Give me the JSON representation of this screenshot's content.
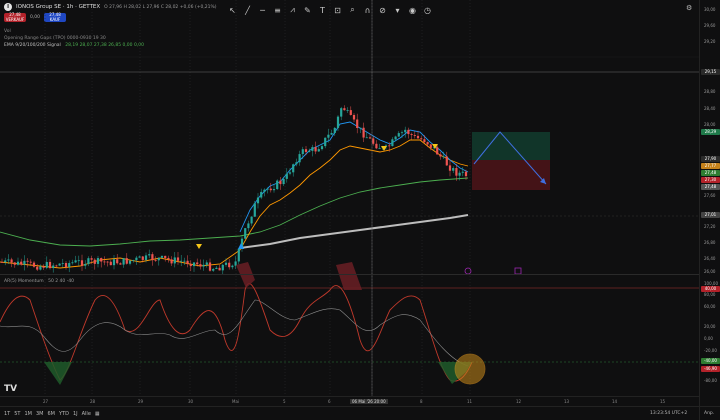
{
  "symbol": {
    "logo": "I",
    "title": "IONOS Group SE · 1h · GETTEX",
    "ohlc": "O 27,96  H 28,02  L 27,96  C 28,02  +0,06 (+0,21%)"
  },
  "trade": {
    "sell_price": "27,48",
    "sell_label": "VERKAUF",
    "spread": "0,00",
    "buy_price": "27,48",
    "buy_label": "KAUF"
  },
  "indicators": {
    "vol": "Vol",
    "vrp": "Opening Range Gaps (TPO) 0000-0930 19 30",
    "ema": "EMA 9/20/100/200 Signal",
    "ema_values": "28,19  28,07  27,38  26,85  0,00  0,00"
  },
  "toolbar_icons": [
    "cursor-icon",
    "line-icon",
    "hline-icon",
    "fib-icon",
    "pattern-icon",
    "brush-icon",
    "text-icon",
    "measure-icon",
    "zoom-icon",
    "magnet-icon",
    "lock-icon",
    "trash-icon",
    "eye-icon",
    "clock-icon"
  ],
  "price_axis": {
    "ticks": [
      "30,00",
      "29,60",
      "29,20",
      "28,80",
      "28,40",
      "28,00",
      "27,60",
      "27,20",
      "26,80",
      "26,40",
      "26,00"
    ],
    "crosshair_label": "29,15",
    "labels": [
      {
        "text": "28,29",
        "color": "#1f7a4a"
      },
      {
        "text": "27,90",
        "color": "#2b2b2b"
      },
      {
        "text": "27,77",
        "color": "#c6821b"
      },
      {
        "text": "27,48",
        "color": "#2e7d32"
      },
      {
        "text": "27,30",
        "color": "#b3222a"
      },
      {
        "text": "27,48",
        "color": "#555555"
      },
      {
        "text": "27,01",
        "color": "#888888"
      }
    ]
  },
  "momentum": {
    "label": "AR(5) Momentum",
    "params": "50  2  40  -40",
    "ticks": [
      "100,00",
      "80,00",
      "60,00",
      "40,00",
      "20,00",
      "0,00",
      "-20,00",
      "-40,00",
      "-60,00",
      "-80,00"
    ],
    "badge_pos": "40,00",
    "badge_neg": "-40,00",
    "badge_zero": "-46,90"
  },
  "time_axis": {
    "ticks": [
      "27",
      "28",
      "29",
      "30",
      "Mai",
      "5",
      "6",
      "7",
      "8",
      "11",
      "12",
      "13",
      "14",
      "15"
    ],
    "crosshair": "06 Mai '26  20:00"
  },
  "bottom": {
    "ranges": [
      "1T",
      "5T",
      "1M",
      "3M",
      "6M",
      "YTD",
      "1J",
      "Alle"
    ],
    "clock": "13:23:54 UTC+2",
    "adj": "Anp."
  },
  "colors": {
    "up": "#26a69a",
    "down": "#ef5350",
    "ema9": "#2196f3",
    "ema20": "#ff9800",
    "ema100": "#4caf50",
    "ema200": "#bdbdbd"
  }
}
